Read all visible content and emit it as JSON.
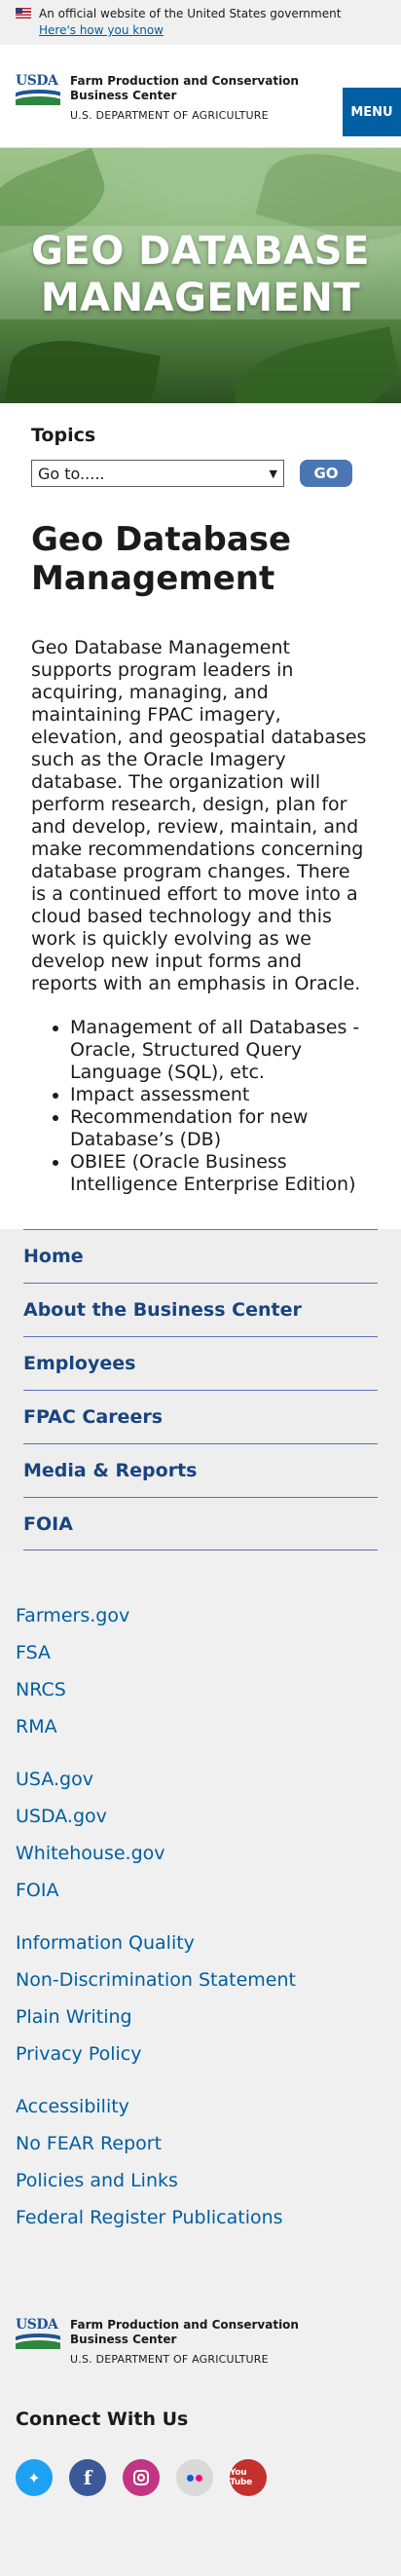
{
  "banner": {
    "text": "An official website of the United States government",
    "link": "Here's how you know"
  },
  "header": {
    "agency_name": "Farm Production and Conservation Business Center",
    "department": "U.S. DEPARTMENT OF AGRICULTURE",
    "menu_label": "MENU"
  },
  "hero": {
    "title": "GEO DATABASE MANAGEMENT"
  },
  "topics": {
    "label": "Topics",
    "select_value": "Go to.....",
    "go_label": "GO"
  },
  "main": {
    "title": "Geo Database Management",
    "intro": "Geo Database Management supports program leaders in acquiring, managing, and maintaining FPAC imagery, elevation, and geospatial databases such as the Oracle Imagery database. The organization will perform research, design, plan for and develop, review, maintain, and make recommendations concerning database program changes. There is a continued effort to move into a cloud based technology and this work is quickly evolving as we develop new input forms and reports with an emphasis in Oracle.",
    "bullets": [
      "Management of all Databases - Oracle, Structured Query Language (SQL), etc.",
      "Impact assessment",
      "Recommendation for new Database’s (DB)",
      "OBIEE (Oracle Business Intelligence Enterprise Edition)"
    ]
  },
  "sidenav": {
    "items": [
      "Home",
      "About the Business Center",
      "Employees",
      "FPAC Careers",
      "Media & Reports",
      "FOIA"
    ]
  },
  "footer": {
    "groups": [
      [
        "Farmers.gov",
        "FSA",
        "NRCS",
        "RMA"
      ],
      [
        "USA.gov",
        "USDA.gov",
        "Whitehouse.gov",
        "FOIA"
      ],
      [
        "Information Quality",
        "Non-Discrimination Statement",
        "Plain Writing",
        "Privacy Policy"
      ],
      [
        "Accessibility",
        "No FEAR Report",
        "Policies and Links",
        "Federal Register Publications"
      ]
    ],
    "agency_name": "Farm Production and Conservation Business Center",
    "department": "U.S. DEPARTMENT OF AGRICULTURE",
    "connect_heading": "Connect With Us",
    "social": [
      "twitter-icon",
      "facebook-icon",
      "instagram-icon",
      "flickr-icon",
      "youtube-icon"
    ],
    "youtube_text": "You Tube"
  },
  "colors": {
    "link": "#005ea2",
    "nav_text": "#1a4480",
    "go_button": "#4a77b4"
  }
}
